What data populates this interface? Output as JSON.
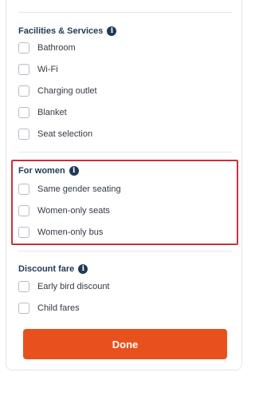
{
  "sections": {
    "facilities": {
      "title": "Facilities & Services",
      "info_icon": "info-icon",
      "items": [
        {
          "label": "Bathroom",
          "checked": false
        },
        {
          "label": "Wi-Fi",
          "checked": false
        },
        {
          "label": "Charging outlet",
          "checked": false
        },
        {
          "label": "Blanket",
          "checked": false
        },
        {
          "label": "Seat selection",
          "checked": false
        }
      ]
    },
    "for_women": {
      "title": "For women",
      "info_icon": "info-icon",
      "highlighted": true,
      "highlight_color": "#c8323c",
      "items": [
        {
          "label": "Same gender seating",
          "checked": false
        },
        {
          "label": "Women-only seats",
          "checked": false
        },
        {
          "label": "Women-only bus",
          "checked": false
        }
      ]
    },
    "discount_fare": {
      "title": "Discount fare",
      "info_icon": "info-icon",
      "items": [
        {
          "label": "Early bird discount",
          "checked": false
        },
        {
          "label": "Child fares",
          "checked": false
        }
      ]
    }
  },
  "done_button": {
    "label": "Done",
    "color": "#e8511d"
  },
  "colors": {
    "heading": "#1f3a57",
    "text": "#333a44",
    "divider": "#e5e7eb"
  }
}
